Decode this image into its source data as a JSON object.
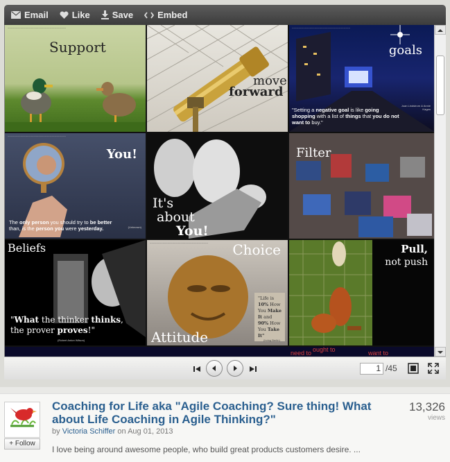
{
  "toolbar": {
    "email_label": "Email",
    "like_label": "Like",
    "save_label": "Save",
    "embed_label": "Embed"
  },
  "slides": [
    {
      "caption": "Support"
    },
    {
      "caption_line1": "move",
      "caption_line2": "forward"
    },
    {
      "caption": "goals",
      "quote_prefix": "\"Setting a ",
      "quote_bold1": "negative goal",
      "quote_mid1": " is like ",
      "quote_bold2": "going shopping",
      "quote_mid2": " with a list of ",
      "quote_bold3": "things",
      "quote_mid3": " that ",
      "quote_bold4": "you do not want to",
      "quote_end": " buy.\"",
      "attribution": "Joan Lindstrom & Annie Kagan"
    },
    {
      "caption": "You!",
      "quote_1": "The ",
      "quote_b1": "only person",
      "quote_2": " you should try to ",
      "quote_b2": "be better",
      "quote_3": "than, is the ",
      "quote_b3": "person you",
      "quote_4": " were ",
      "quote_b4": "yesterday.",
      "attribution": "(Unknown)"
    },
    {
      "caption_line1": "It's",
      "caption_line2": "about",
      "caption_line3": "You!"
    },
    {
      "caption": "Filter"
    },
    {
      "caption": "Beliefs",
      "quote_1": "\"",
      "quote_b1": "What",
      "quote_2": " the thinker ",
      "quote_b2": "thinks",
      "quote_3": ",",
      "quote_4": "the prover ",
      "quote_b4": "proves",
      "quote_5": "!\"",
      "attribution": "(Robert Anton Wilson)"
    },
    {
      "caption_top": "Choice",
      "caption_bottom": "Attitude",
      "quote_a": "\"Life is",
      "quote_b": "10%",
      "quote_c": " How",
      "quote_d": "You ",
      "quote_e": "Make",
      "quote_f": "It",
      "quote_g": " and",
      "quote_h": "90%",
      "quote_i": " How",
      "quote_j": "You ",
      "quote_k": "Take",
      "quote_l": "It\"",
      "attribution": "(Irving Berlin)"
    },
    {
      "caption_line1": "Pull,",
      "caption_line2": "not push"
    }
  ],
  "peek": {
    "left": "need to",
    "mid": "ought to",
    "right": "want to"
  },
  "controls": {
    "first_icon": "skip-first-icon",
    "prev_icon": "prev-arrow-icon",
    "next_icon": "next-arrow-icon",
    "last_icon": "skip-last-icon",
    "current_page": "1",
    "total_pages": "/45",
    "fullscreen_icon": "fullscreen-icon",
    "expand_icon": "expand-icon"
  },
  "info": {
    "title": "Coaching for Life aka \"Agile Coaching? Sure thing! What about Life Coaching in Agile Thinking?\"",
    "by_label": "by",
    "author": "Victoria Schiffer",
    "on_label": "on",
    "date": "Aug 01, 2013",
    "description": "I love being around awesome people, who build great products customers desire. ...",
    "views_count": "13,326",
    "views_label": "views",
    "follow_label": "+ Follow"
  },
  "colors": {
    "link": "#2a5f8f",
    "toolbar": "#4a4a4a"
  }
}
